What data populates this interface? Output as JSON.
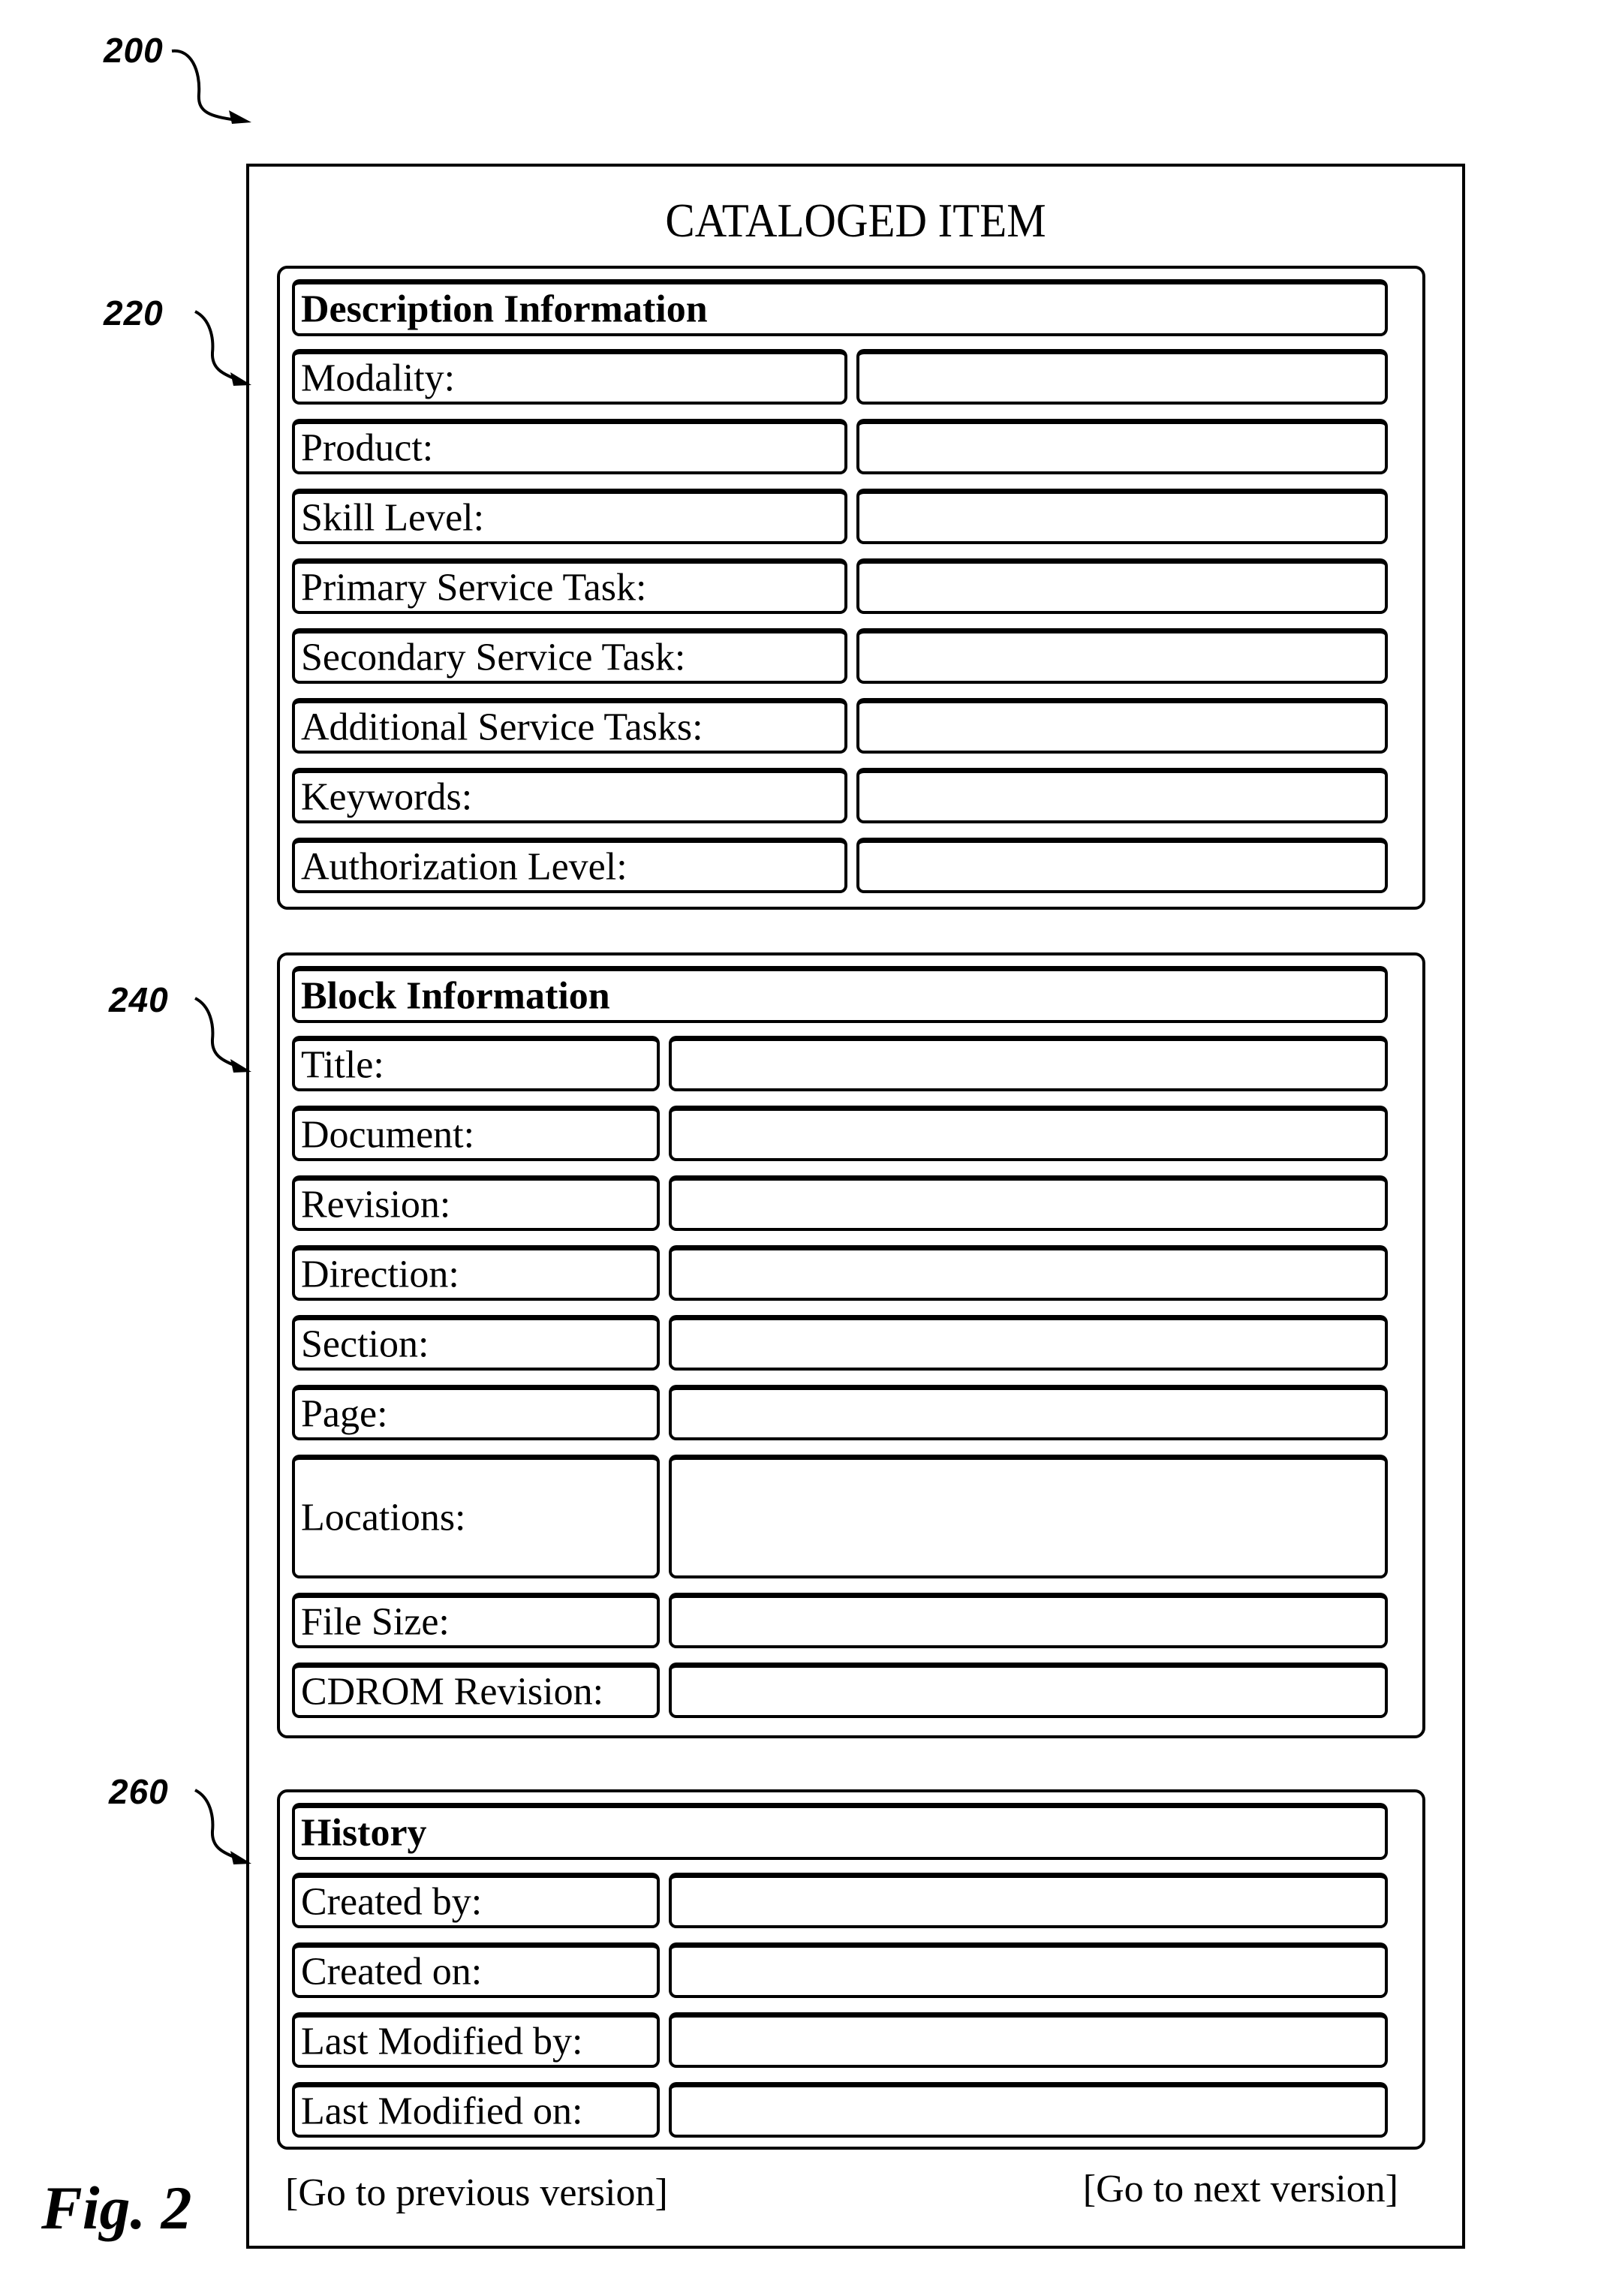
{
  "figure_label": "Fig. 2",
  "reference_numerals": {
    "window": "200",
    "description_section": "220",
    "block_section": "240",
    "history_section": "260"
  },
  "window": {
    "title": "CATALOGED ITEM"
  },
  "sections": {
    "description": {
      "header": "Description Information",
      "fields": [
        {
          "label": "Modality:",
          "value": ""
        },
        {
          "label": "Product:",
          "value": ""
        },
        {
          "label": "Skill Level:",
          "value": ""
        },
        {
          "label": "Primary Service Task:",
          "value": ""
        },
        {
          "label": "Secondary Service Task:",
          "value": ""
        },
        {
          "label": "Additional Service Tasks:",
          "value": ""
        },
        {
          "label": "Keywords:",
          "value": ""
        },
        {
          "label": "Authorization Level:",
          "value": ""
        }
      ]
    },
    "block": {
      "header": "Block Information",
      "fields": [
        {
          "label": "Title:",
          "value": ""
        },
        {
          "label": "Document:",
          "value": ""
        },
        {
          "label": "Revision:",
          "value": ""
        },
        {
          "label": "Direction:",
          "value": ""
        },
        {
          "label": "Section:",
          "value": ""
        },
        {
          "label": "Page:",
          "value": ""
        },
        {
          "label": "Locations:",
          "value": ""
        },
        {
          "label": "File Size:",
          "value": ""
        },
        {
          "label": "CDROM Revision:",
          "value": ""
        }
      ]
    },
    "history": {
      "header": "History",
      "fields": [
        {
          "label": "Created by:",
          "value": ""
        },
        {
          "label": "Created on:",
          "value": ""
        },
        {
          "label": "Last Modified by:",
          "value": ""
        },
        {
          "label": "Last Modified on:",
          "value": ""
        }
      ]
    }
  },
  "navigation": {
    "previous": "[Go to previous version]",
    "next": "[Go to next version]"
  }
}
